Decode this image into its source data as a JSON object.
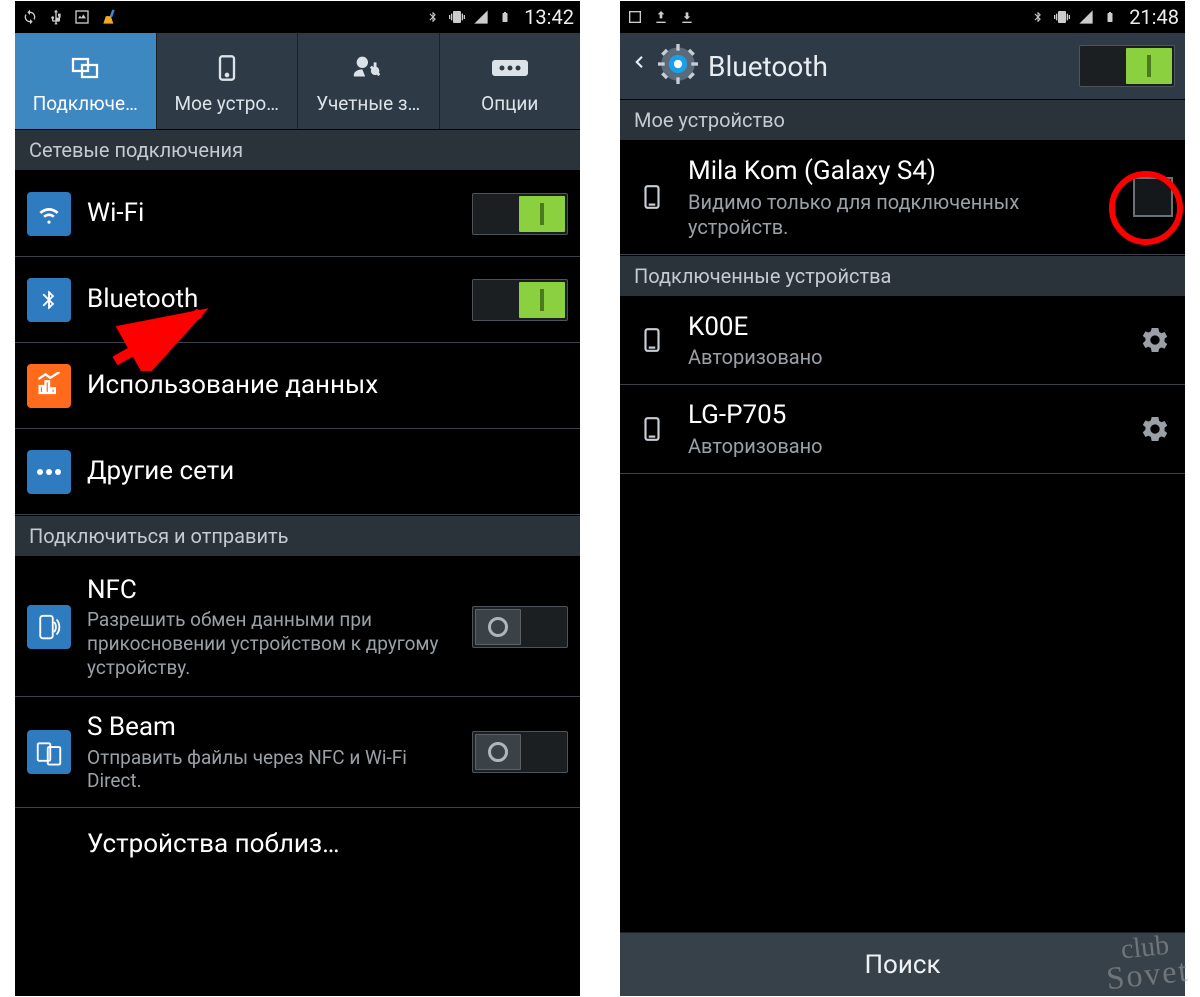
{
  "left": {
    "status": {
      "time": "13:42"
    },
    "tabs": [
      {
        "label": "Подключе…",
        "icon": "connections-icon",
        "active": true
      },
      {
        "label": "Мое устро…",
        "icon": "device-icon",
        "active": false
      },
      {
        "label": "Учетные з…",
        "icon": "accounts-icon",
        "active": false
      },
      {
        "label": "Опции",
        "icon": "more-icon",
        "active": false
      }
    ],
    "sections": [
      {
        "header": "Сетевые подключения",
        "rows": [
          {
            "title": "Wi-Fi",
            "icon": "wifi-icon",
            "toggle": "on"
          },
          {
            "title": "Bluetooth",
            "icon": "bluetooth-icon",
            "toggle": "on"
          },
          {
            "title": "Использование данных",
            "icon": "data-usage-icon"
          },
          {
            "title": "Другие сети",
            "icon": "more-networks-icon"
          }
        ]
      },
      {
        "header": "Подключиться и отправить",
        "rows": [
          {
            "title": "NFC",
            "sub": "Разрешить обмен данными при прикосновении устройством к другому устройству.",
            "icon": "nfc-icon",
            "toggle": "off"
          },
          {
            "title": "S Beam",
            "sub": "Отправить файлы через NFC и Wi-Fi Direct.",
            "icon": "sbeam-icon",
            "toggle": "off"
          },
          {
            "title": "Устройства поблиз…",
            "icon": "nearby-devices-icon"
          }
        ]
      }
    ]
  },
  "right": {
    "status": {
      "time": "21:48"
    },
    "header": {
      "title": "Bluetooth",
      "toggle": "on"
    },
    "sections": [
      {
        "header": "Мое устройство",
        "rows": [
          {
            "title": "Mila Kom (Galaxy S4)",
            "sub": "Видимо только для подключенных устройств.",
            "checkbox": true
          }
        ]
      },
      {
        "header": "Подключенные устройства",
        "rows": [
          {
            "title": "K00E",
            "sub": "Авторизовано",
            "gear": true
          },
          {
            "title": "LG-P705",
            "sub": "Авторизовано",
            "gear": true
          }
        ]
      }
    ],
    "search_button": "Поиск"
  },
  "watermark": {
    "line1": "club",
    "line2": "Sovet"
  }
}
